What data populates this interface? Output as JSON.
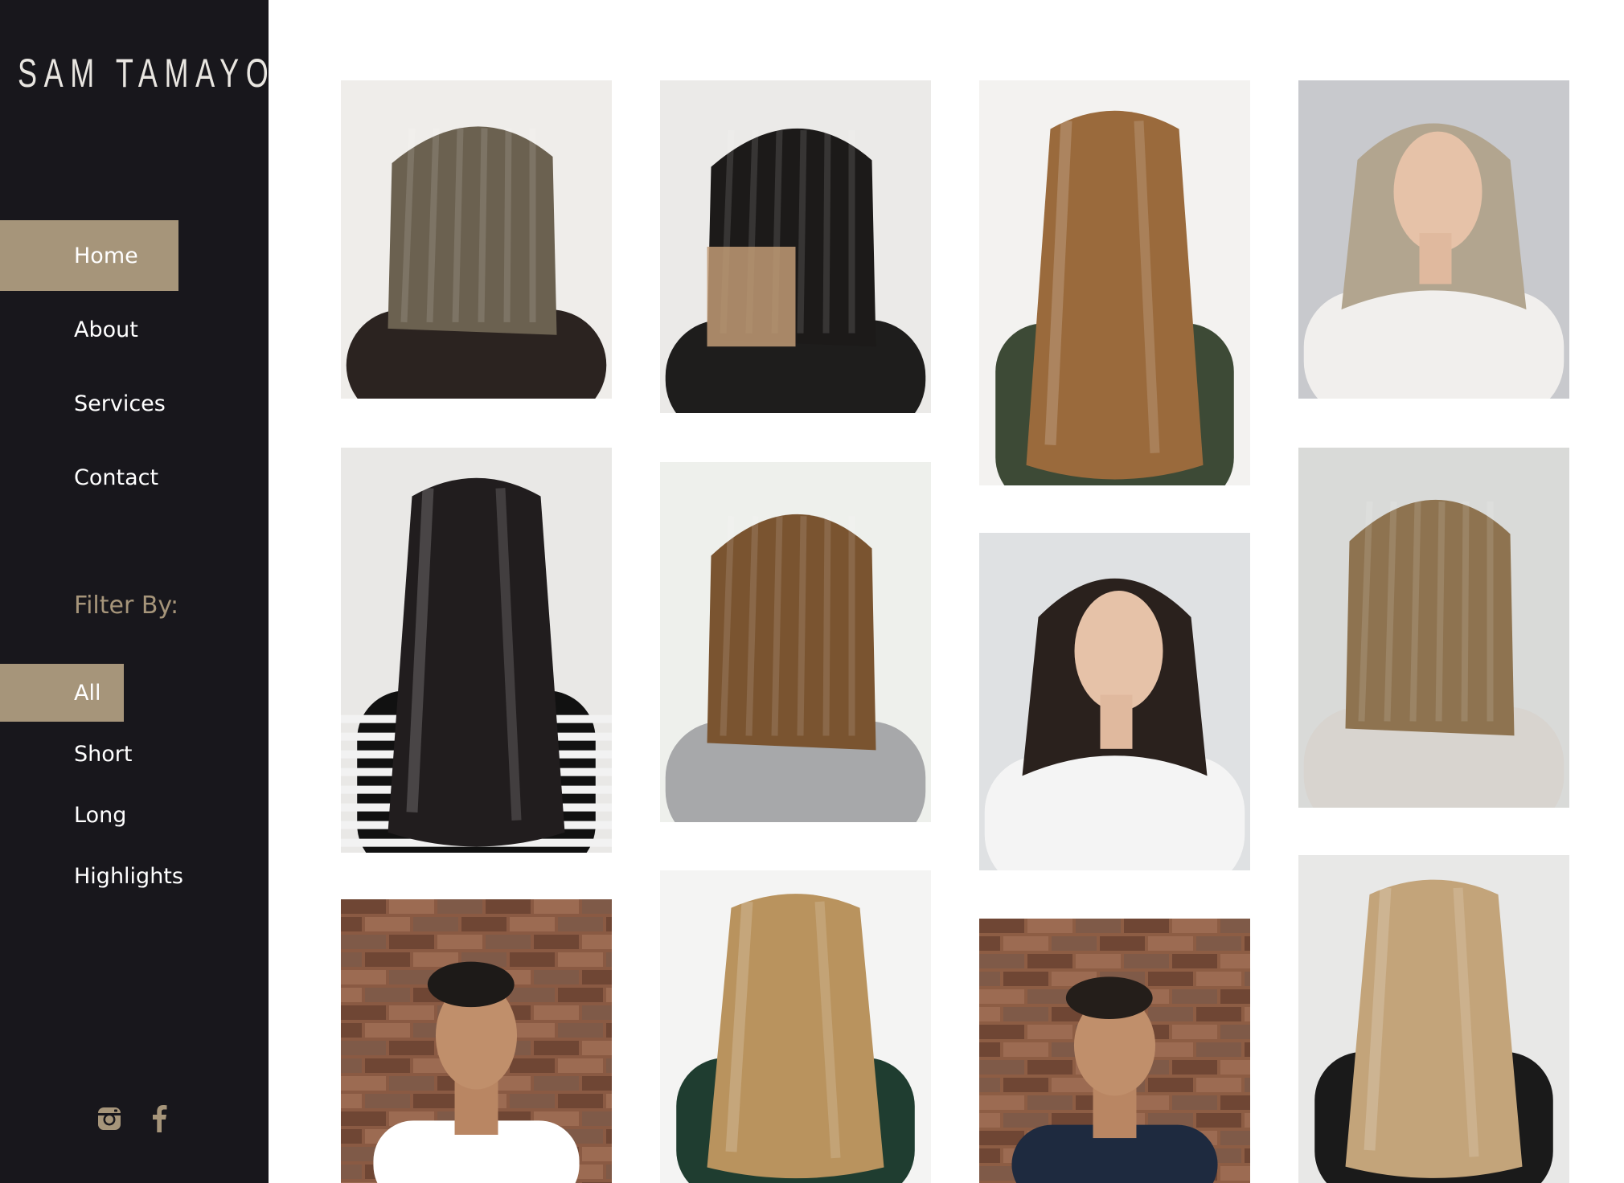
{
  "brand": {
    "name": "SAM TAMAYO"
  },
  "nav": {
    "items": [
      {
        "label": "Home",
        "active": true
      },
      {
        "label": "About",
        "active": false
      },
      {
        "label": "Services",
        "active": false
      },
      {
        "label": "Contact",
        "active": false
      }
    ]
  },
  "filter": {
    "title": "Filter By:",
    "items": [
      {
        "label": "All",
        "active": true
      },
      {
        "label": "Short",
        "active": false
      },
      {
        "label": "Long",
        "active": false
      },
      {
        "label": "Highlights",
        "active": false
      }
    ]
  },
  "social": {
    "icons": [
      "instagram-icon",
      "facebook-icon"
    ]
  },
  "colors": {
    "sidebar": "#18171c",
    "accent": "#a6957a",
    "text": "#ffffff"
  },
  "gallery": {
    "photos": [
      {
        "hair": "#6b6150",
        "bg": "#efedea",
        "style": "bob-side",
        "shirt": "#2b2320"
      },
      {
        "hair": "#1c1a19",
        "bg": "#ebeae8",
        "style": "bob-ombre",
        "shirt": "#1e1d1c"
      },
      {
        "hair": "#9a6a3c",
        "bg": "#f3f2f0",
        "style": "long-back",
        "shirt": "#3d4a36"
      },
      {
        "hair": "#b2a58f",
        "bg": "#c8c9cd",
        "style": "face-blonde",
        "shirt": "#f1efed"
      },
      {
        "hair": "#211d1e",
        "bg": "#e9e8e6",
        "style": "long-dark-stripe",
        "shirt": "#111111"
      },
      {
        "hair": "#7a5430",
        "bg": "#eef0ec",
        "style": "bob-side",
        "shirt": "#a7a8aa"
      },
      {
        "hair": "#2a211d",
        "bg": "#dfe1e3",
        "style": "face-dark",
        "shirt": "#f4f4f4"
      },
      {
        "hair": "#8e7350",
        "bg": "#d9dad8",
        "style": "bob-back",
        "shirt": "#d8d4cf"
      },
      {
        "hair": "#1d1a18",
        "bg": "#8a5a43",
        "style": "man-brick",
        "shirt": "#ffffff"
      },
      {
        "hair": "#b9935e",
        "bg": "#f4f4f3",
        "style": "long-back",
        "shirt": "#1f3d30"
      },
      {
        "hair": "#241e1a",
        "bg": "#8d5d44",
        "style": "man-brick",
        "shirt": "#1e2a3f"
      },
      {
        "hair": "#c3a47a",
        "bg": "#e8e8e7",
        "style": "long-back",
        "shirt": "#1a1a1a"
      }
    ]
  }
}
